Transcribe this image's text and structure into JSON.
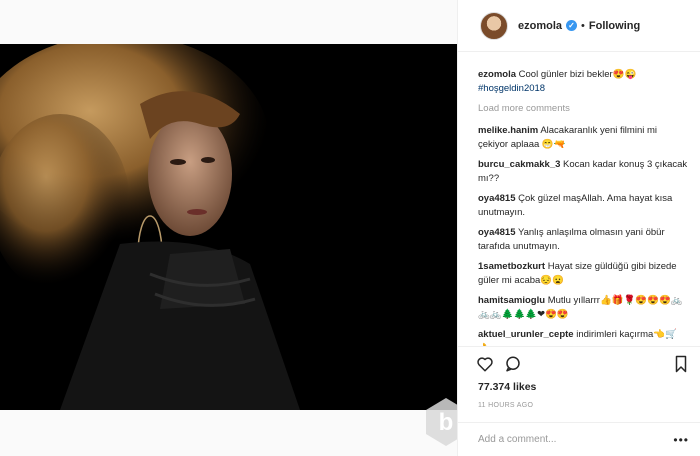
{
  "post": {
    "username": "ezomola",
    "verified_mark": "✓",
    "separator": "•",
    "follow_status": "Following"
  },
  "caption": {
    "username": "ezomola",
    "text": "Cool günler bizi bekler😍😜",
    "hashtag": "#hoşgeldin2018"
  },
  "load_more_label": "Load more comments",
  "comments": [
    {
      "username": "melike.hanim",
      "text": "Alacakaranlık yeni filmini mi çekiyor aplaaa 😁🔫"
    },
    {
      "username": "burcu_cakmakk_3",
      "text": "Kocan kadar konuş 3 çıkacak mı??"
    },
    {
      "username": "oya4815",
      "text": "Çok güzel maşAllah. Ama hayat kısa unutmayın."
    },
    {
      "username": "oya4815",
      "text": "Yanlış anlaşılma olmasın yani öbür tarafıda unutmayın."
    },
    {
      "username": "1sametbozkurt",
      "text": "Hayat size güldüğü gibi bizede güler mi acaba😔😦"
    },
    {
      "username": "hamitsamioglu",
      "text": "Mutlu yıllarrr👍🎁🌹😍😍😍🚲🚲🚲🌲🌲🌲❤😍😍"
    },
    {
      "username": "aktuel_urunler_cepte",
      "text": "indirimleri kaçırma👈🛒👌"
    }
  ],
  "likes": "77.374 likes",
  "time_ago": "11 HOURS AGO",
  "add_comment_placeholder": "Add a comment...",
  "more_options": "•••",
  "colors": {
    "verified": "#3897f0",
    "hashtag": "#003569",
    "muted": "#999999"
  },
  "icons": [
    "heart-icon",
    "comment-icon",
    "bookmark-icon",
    "watermark-logo"
  ]
}
